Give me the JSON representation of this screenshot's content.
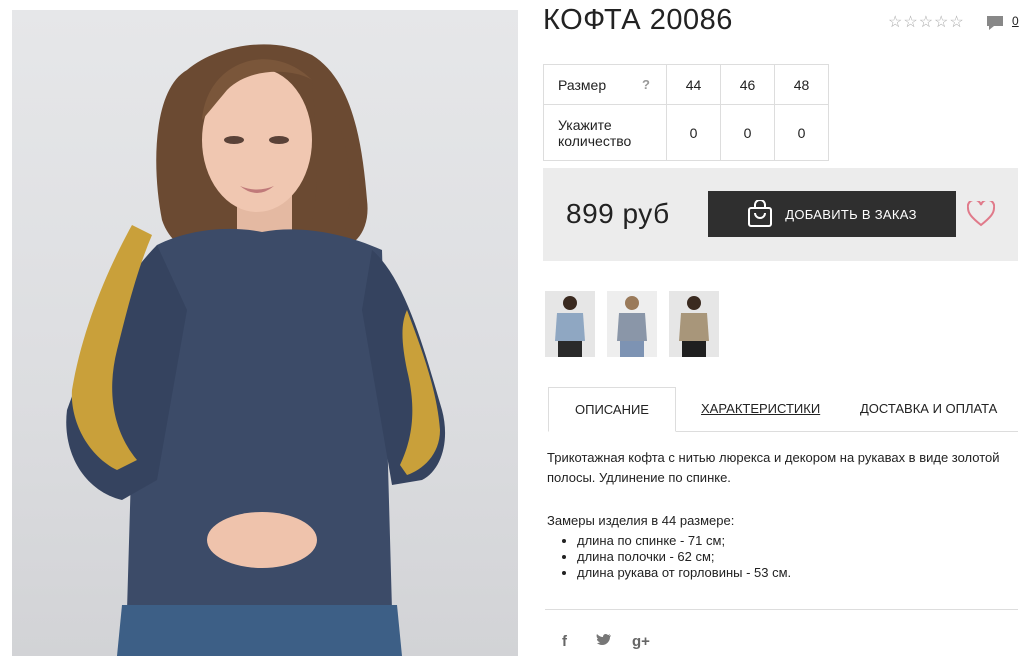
{
  "product": {
    "title": "КОФТА 20086",
    "rating": "☆☆☆☆☆",
    "comments_count": "0",
    "price": "899 руб",
    "add_to_cart": "ДОБАВИТЬ В ЗАКАЗ"
  },
  "sizes": {
    "size_label": "Размер",
    "help": "?",
    "qty_label": "Укажите количество",
    "values": [
      "44",
      "46",
      "48"
    ],
    "quantities": [
      "0",
      "0",
      "0"
    ]
  },
  "tabs": {
    "description": "ОПИСАНИЕ",
    "specs": "ХАРАКТЕРИСТИКИ",
    "delivery": "ДОСТАВКА И ОПЛАТА"
  },
  "description": {
    "text": "Трикотажная кофта с нитью люрекса и декором на рукавах в виде золотой полосы. Удлинение по спинке.",
    "measures_title": "Замеры изделия в 44 размере:",
    "measures": [
      "длина по спинке - 71 см;",
      "длина полочки - 62 см;",
      "длина рукава от горловины - 53 см."
    ]
  },
  "social": {
    "facebook": "f",
    "twitter": "🐦",
    "google": "g+"
  },
  "colors": {
    "button": "#2f2f2f",
    "buybox": "#ececec",
    "heart": "#e07a8a",
    "sweater": "#3c4b68",
    "sequin": "#c9a03a"
  }
}
